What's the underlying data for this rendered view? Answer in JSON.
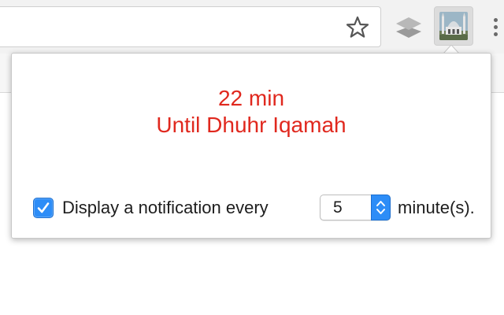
{
  "browser": {
    "icons": {
      "bookmark": "star-icon",
      "extension_1": "layers-icon",
      "extension_2": "mosque-icon",
      "menu": "three-dots-vertical-icon"
    }
  },
  "popup": {
    "countdown_time": "22 min",
    "countdown_label": "Until Dhuhr Iqamah",
    "notification": {
      "enabled": true,
      "label_before": "Display a notification every",
      "interval_value": "5",
      "label_after": "minute(s)."
    }
  },
  "colors": {
    "countdown_text": "#e0281e",
    "checkbox_accent": "#2d8df7"
  }
}
